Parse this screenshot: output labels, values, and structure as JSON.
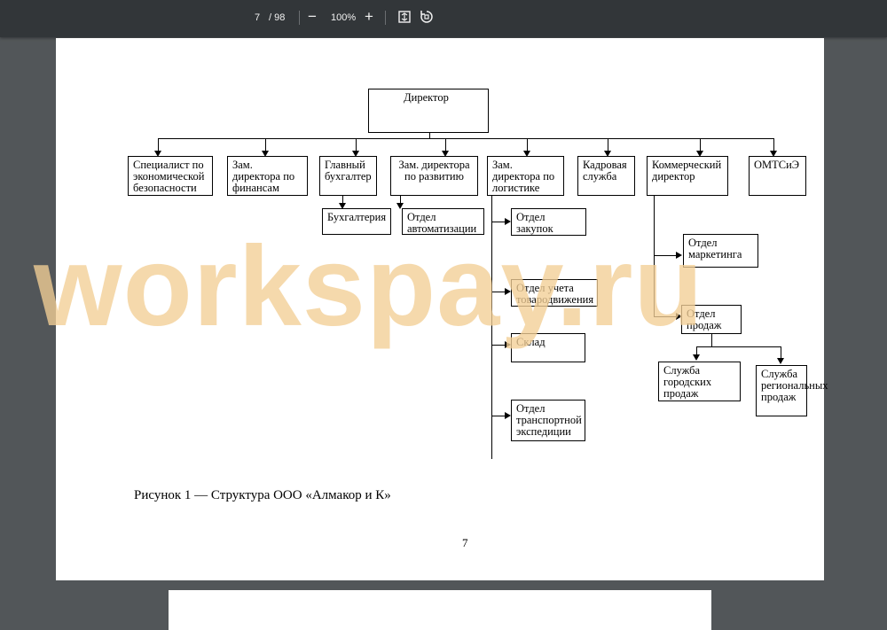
{
  "toolbar": {
    "page_current": "7",
    "page_total": "/ 98",
    "zoom": "100%",
    "zoom_out_icon": "minus-icon",
    "zoom_in_icon": "plus-icon",
    "fit_icon": "fit-page-icon",
    "rotate_icon": "rotate-icon"
  },
  "watermark": "workspay.ru",
  "diagram": {
    "director": "Директор",
    "specialist": "Специалист по экономической безопасности",
    "zam_finance": "Зам. директора по финансам",
    "chief_accountant": "Главный бухгалтер",
    "zam_development": "Зам. директора по развитию",
    "zam_logistics": "Зам. директора по логистике",
    "hr": "Кадровая служба",
    "commercial": "Коммерческий директор",
    "omtsie": "ОМТСиЭ",
    "accounting": "Бухгалтерия",
    "automation": "Отдел автоматизации",
    "purchasing": "Отдел закупок",
    "goods_movement": "Отдел учета товародвижения",
    "warehouse": "Склад",
    "transport": "Отдел транспортной экспедиции",
    "marketing": "Отдел маркетинга",
    "sales": "Отдел продаж",
    "city_sales": "Служба городских продаж",
    "regional_sales": "Служба региональных продаж"
  },
  "caption": "Рисунок 1 — Структура ООО «Алмакор и К»",
  "page_number": "7"
}
